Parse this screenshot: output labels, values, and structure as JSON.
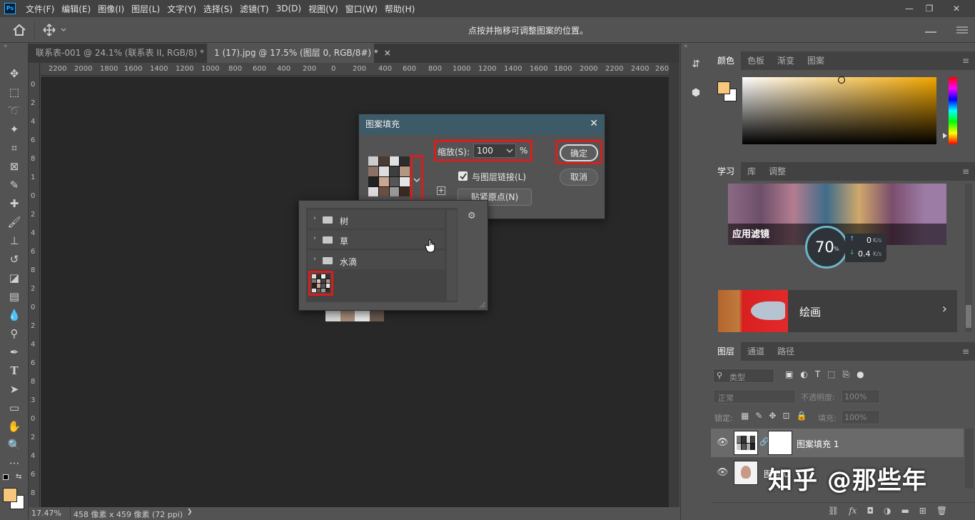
{
  "menubar": {
    "logo": "Ps",
    "items": [
      "文件(F)",
      "编辑(E)",
      "图像(I)",
      "图层(L)",
      "文字(Y)",
      "选择(S)",
      "滤镜(T)",
      "3D(D)",
      "视图(V)",
      "窗口(W)",
      "帮助(H)"
    ],
    "minimize": "—",
    "restore": "❐",
    "close": "✕"
  },
  "options": {
    "hint": "点按并拖移可调整图案的位置。"
  },
  "tabs": [
    {
      "label": "联系表-001 @ 24.1% (联系表 II, RGB/8) *",
      "close": "×"
    },
    {
      "label": "1 (17).jpg @ 17.5% (图层 0, RGB/8#) *",
      "close": "×"
    }
  ],
  "ruler": {
    "top": [
      "2200",
      "2000",
      "1800",
      "1600",
      "1400",
      "1200",
      "1000",
      "800",
      "600",
      "400",
      "200",
      "0",
      "200",
      "400",
      "600",
      "800",
      "1000",
      "1200",
      "1400",
      "1600",
      "1800",
      "2000",
      "2200",
      "2400",
      "260"
    ],
    "left": [
      "0",
      "2",
      "4",
      "6",
      "8",
      "1",
      "0",
      "2",
      "4",
      "6",
      "8",
      "2",
      "0",
      "2",
      "4",
      "6",
      "8",
      "3",
      "0",
      "2",
      "4",
      "6",
      "8"
    ]
  },
  "status": {
    "zoom": "17.47%",
    "doc_info": "458 像素 x 459 像素 (72 ppi)",
    "arrow": "❯"
  },
  "dialog": {
    "title": "图案填充",
    "close": "✕",
    "scale_label": "缩放(S):",
    "scale_value": "100",
    "scale_unit": "%",
    "link_label": "与图层链接(L)",
    "snap_label": "贴紧原点(N)",
    "ok": "确定",
    "cancel": "取消"
  },
  "picker": {
    "folders": [
      "树",
      "草",
      "水滴"
    ],
    "gear": "⚙"
  },
  "color_panel": {
    "tabs": [
      "颜色",
      "色板",
      "渐变",
      "图案"
    ],
    "fg": "#f6c77d",
    "bg": "#ffffff"
  },
  "learn_panel": {
    "tabs": [
      "学习",
      "库",
      "调整"
    ],
    "card1_label": "应用滤镜",
    "card2_label": "绘画",
    "meter_value": "70",
    "meter_unit": "%",
    "up_value": "0",
    "up_unit": "K/s",
    "down_value": "0.4",
    "down_unit": "K/s"
  },
  "layers_panel": {
    "tabs": [
      "图层",
      "通道",
      "路径"
    ],
    "filter_label": "类型",
    "blend_mode": "正常",
    "opacity_label": "不透明度:",
    "opacity_value": "100%",
    "lock_label": "锁定:",
    "fill_label": "填充:",
    "fill_value": "100%",
    "layers": [
      {
        "name": "图案填充 1"
      },
      {
        "name": "图层 0"
      }
    ]
  },
  "watermark": "知乎 @那些年",
  "colors": {
    "accent_red": "#d91e1e",
    "dialog_title": "#3d5a68"
  }
}
